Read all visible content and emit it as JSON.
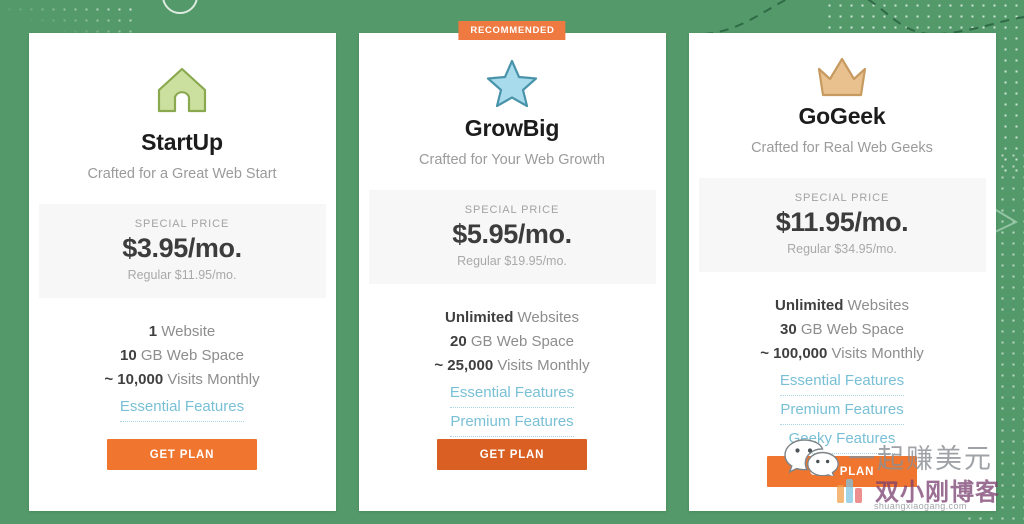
{
  "page": {
    "background_color": "#539969",
    "accent_color": "#f0762f",
    "link_color": "#79c0d6"
  },
  "plans": [
    {
      "icon": "house-icon",
      "icon_fill": "#cbdf9e",
      "icon_stroke": "#8aa94f",
      "name": "StartUp",
      "tagline": "Crafted for a Great Web Start",
      "badge": "",
      "price_label": "SPECIAL PRICE",
      "price_main": "$3.95/mo.",
      "price_regular": "Regular $11.95/mo.",
      "features": [
        {
          "value": "1",
          "text": " Website"
        },
        {
          "value": "10",
          "text": " GB Web Space"
        },
        {
          "value": "~ 10,000",
          "text": " Visits Monthly"
        }
      ],
      "feature_links": [
        "Essential Features"
      ],
      "cta_label": "GET PLAN",
      "cta_hover": false
    },
    {
      "icon": "star-icon",
      "icon_fill": "#a8dcec",
      "icon_stroke": "#4a94ab",
      "name": "GrowBig",
      "tagline": "Crafted for Your Web Growth",
      "badge": "RECOMMENDED",
      "price_label": "SPECIAL PRICE",
      "price_main": "$5.95/mo.",
      "price_regular": "Regular $19.95/mo.",
      "features": [
        {
          "value": "Unlimited",
          "text": " Websites"
        },
        {
          "value": "20",
          "text": " GB Web Space"
        },
        {
          "value": "~ 25,000",
          "text": " Visits Monthly"
        }
      ],
      "feature_links": [
        "Essential Features",
        "Premium Features"
      ],
      "cta_label": "GET PLAN",
      "cta_hover": true
    },
    {
      "icon": "crown-icon",
      "icon_fill": "#e9c18f",
      "icon_stroke": "#c79a60",
      "name": "GoGeek",
      "tagline": "Crafted for Real Web Geeks",
      "badge": "",
      "price_label": "SPECIAL PRICE",
      "price_main": "$11.95/mo.",
      "price_regular": "Regular $34.95/mo.",
      "features": [
        {
          "value": "Unlimited",
          "text": " Websites"
        },
        {
          "value": "30",
          "text": " GB Web Space"
        },
        {
          "value": "~ 100,000",
          "text": " Visits Monthly"
        }
      ],
      "feature_links": [
        "Essential Features",
        "Premium Features",
        "Geeky Features"
      ],
      "cta_label": "GET PLAN",
      "cta_hover": false
    }
  ],
  "watermark": {
    "line1": "一起赚美元",
    "line2": "双小刚博客",
    "url": "shuangxiaogang.com",
    "logo": "wechat-logo"
  }
}
